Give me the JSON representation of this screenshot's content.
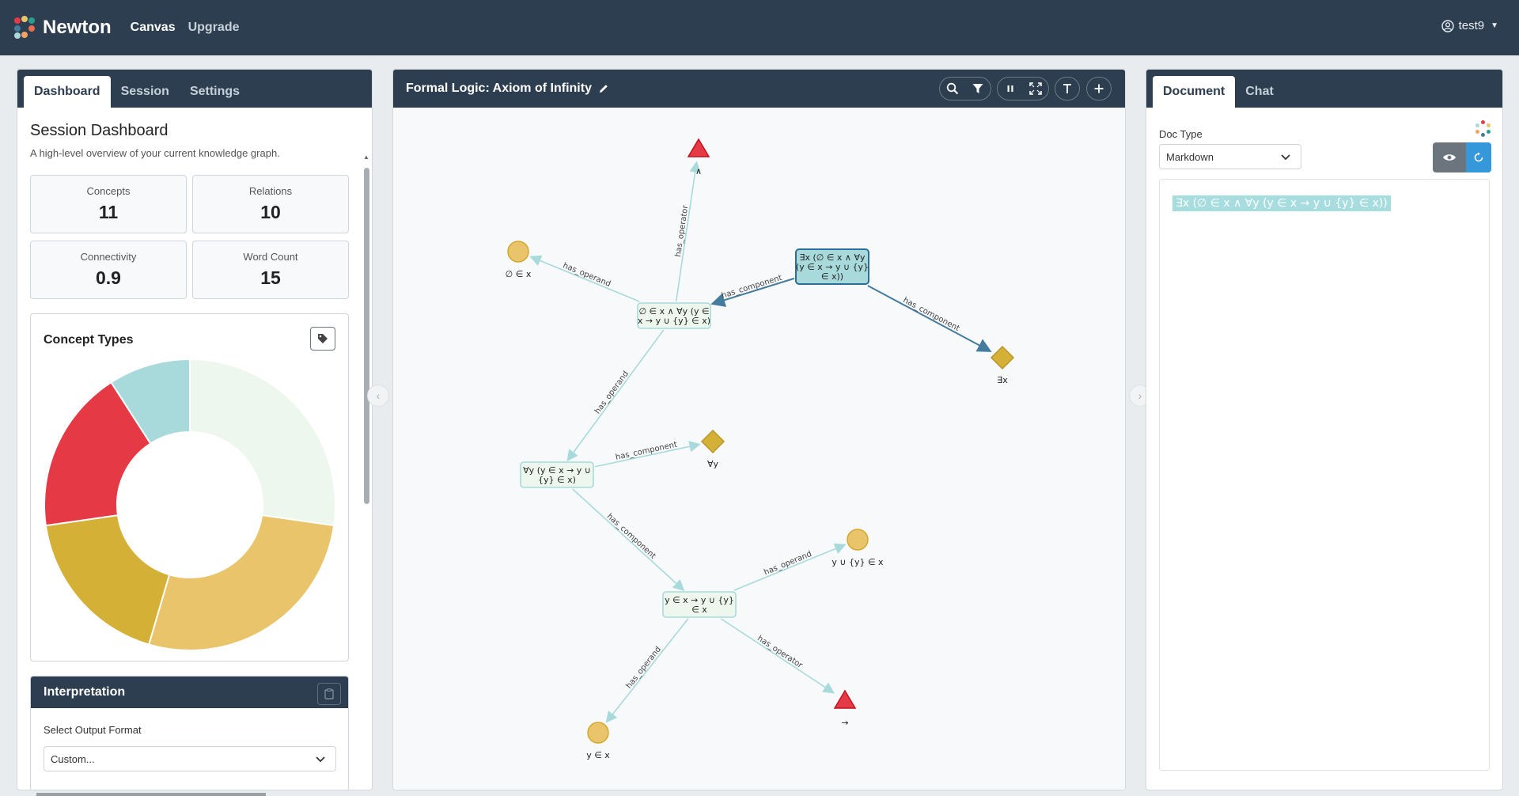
{
  "navbar": {
    "brand": "Newton",
    "links": [
      "Canvas",
      "Upgrade"
    ],
    "user": "test9",
    "logo_colors": [
      "#e63946",
      "#e9c46a",
      "#2a9d8f",
      "#457b9d",
      "#f4a261",
      "#e76f51"
    ]
  },
  "left": {
    "tabs": [
      "Dashboard",
      "Session",
      "Settings"
    ],
    "title": "Session Dashboard",
    "subtitle": "A high-level overview of your current knowledge graph.",
    "stats": [
      {
        "label": "Concepts",
        "value": "11"
      },
      {
        "label": "Relations",
        "value": "10"
      },
      {
        "label": "Connectivity",
        "value": "0.9"
      },
      {
        "label": "Word Count",
        "value": "15"
      }
    ],
    "concept_types_title": "Concept Types",
    "interpretation": {
      "title": "Interpretation",
      "select_label": "Select Output Format",
      "select_value": "Custom..."
    }
  },
  "chart_data": {
    "type": "pie",
    "donut": true,
    "slices": [
      {
        "value": 3,
        "color": "#edf7ee"
      },
      {
        "value": 3,
        "color": "#e9c46a"
      },
      {
        "value": 2,
        "color": "#d4b037"
      },
      {
        "value": 2,
        "color": "#e63946"
      },
      {
        "value": 1,
        "color": "#a8dadc"
      }
    ]
  },
  "center": {
    "title": "Formal Logic: Axiom of Infinity",
    "graph": {
      "nodes": [
        {
          "id": "root",
          "shape": "box",
          "lines": [
            "∃x (∅ ∈ x ∧ ∀y",
            "(y ∈ x → y ∪ {y}",
            "∈ x))"
          ],
          "selected": true
        },
        {
          "id": "conj",
          "shape": "box",
          "lines": [
            "∅ ∈ x ∧ ∀y (y ∈",
            "x → y ∪ {y} ∈ x)"
          ]
        },
        {
          "id": "forall",
          "shape": "box",
          "lines": [
            "∀y (y ∈ x → y ∪",
            "{y} ∈ x)"
          ]
        },
        {
          "id": "impl",
          "shape": "box",
          "lines": [
            "y ∈ x → y ∪ {y}",
            "∈ x"
          ]
        },
        {
          "id": "and_op",
          "shape": "triangle",
          "label": "∧"
        },
        {
          "id": "empty_in",
          "shape": "circle",
          "label": "∅ ∈ x"
        },
        {
          "id": "exists",
          "shape": "diamond",
          "label": "∃x"
        },
        {
          "id": "forall_q",
          "shape": "diamond",
          "label": "∀y"
        },
        {
          "id": "union_in",
          "shape": "circle",
          "label": "y ∪ {y} ∈ x"
        },
        {
          "id": "y_in",
          "shape": "circle",
          "label": "y ∈ x"
        },
        {
          "id": "arrow_op",
          "shape": "triangle",
          "label": "→"
        }
      ],
      "edges": [
        {
          "from": "root",
          "to": "conj",
          "label": "has_component"
        },
        {
          "from": "root",
          "to": "exists",
          "label": "has_component"
        },
        {
          "from": "conj",
          "to": "and_op",
          "label": "has_operator"
        },
        {
          "from": "conj",
          "to": "empty_in",
          "label": "has_operand"
        },
        {
          "from": "conj",
          "to": "forall",
          "label": "has_operand"
        },
        {
          "from": "forall",
          "to": "forall_q",
          "label": "has_component"
        },
        {
          "from": "forall",
          "to": "impl",
          "label": "has_component"
        },
        {
          "from": "impl",
          "to": "union_in",
          "label": "has_operand"
        },
        {
          "from": "impl",
          "to": "y_in",
          "label": "has_operand"
        },
        {
          "from": "impl",
          "to": "arrow_op",
          "label": "has_operator"
        }
      ]
    }
  },
  "right": {
    "tabs": [
      "Document",
      "Chat"
    ],
    "doc_type_label": "Doc Type",
    "doc_type_value": "Markdown",
    "document_text": "∃x (∅ ∈ x ∧ ∀y (y ∈ x → y ∪ {y} ∈ x))"
  }
}
